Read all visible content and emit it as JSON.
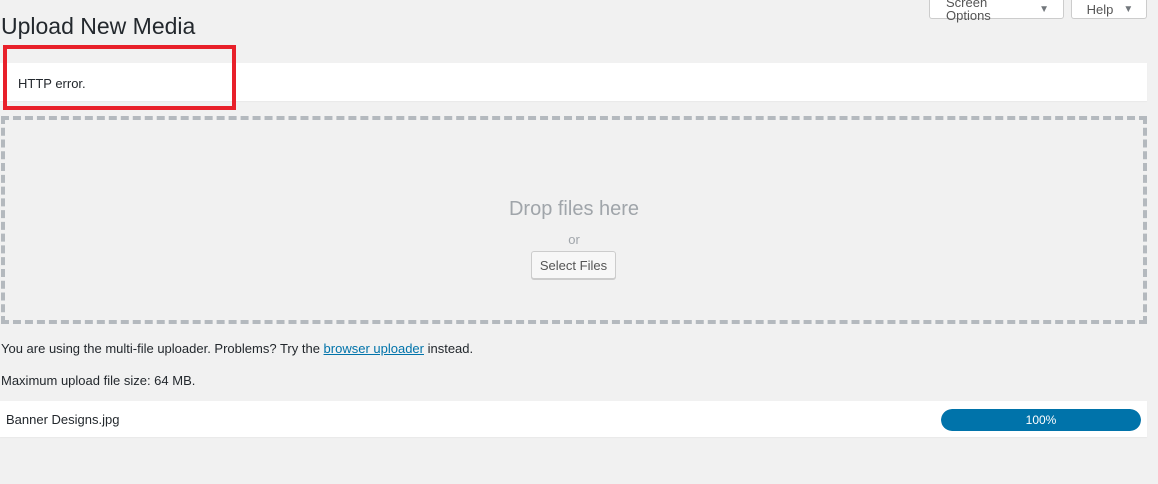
{
  "page": {
    "title": "Upload New Media"
  },
  "screen_meta": {
    "screen_options_label": "Screen Options",
    "help_label": "Help"
  },
  "notice": {
    "message": "HTTP error."
  },
  "drop_area": {
    "title": "Drop files here",
    "or_text": "or",
    "select_button_label": "Select Files"
  },
  "uploader_info": {
    "prefix": "You are using the multi-file uploader. Problems? Try the ",
    "link_text": "browser uploader",
    "suffix": " instead."
  },
  "max_upload": "Maximum upload file size: 64 MB.",
  "upload_item": {
    "filename": "Banner Designs.jpg",
    "progress_percent": 100,
    "progress_label": "100%"
  },
  "colors": {
    "accent": "#0073aa",
    "highlight": "#e8202a",
    "background": "#f1f1f1"
  }
}
